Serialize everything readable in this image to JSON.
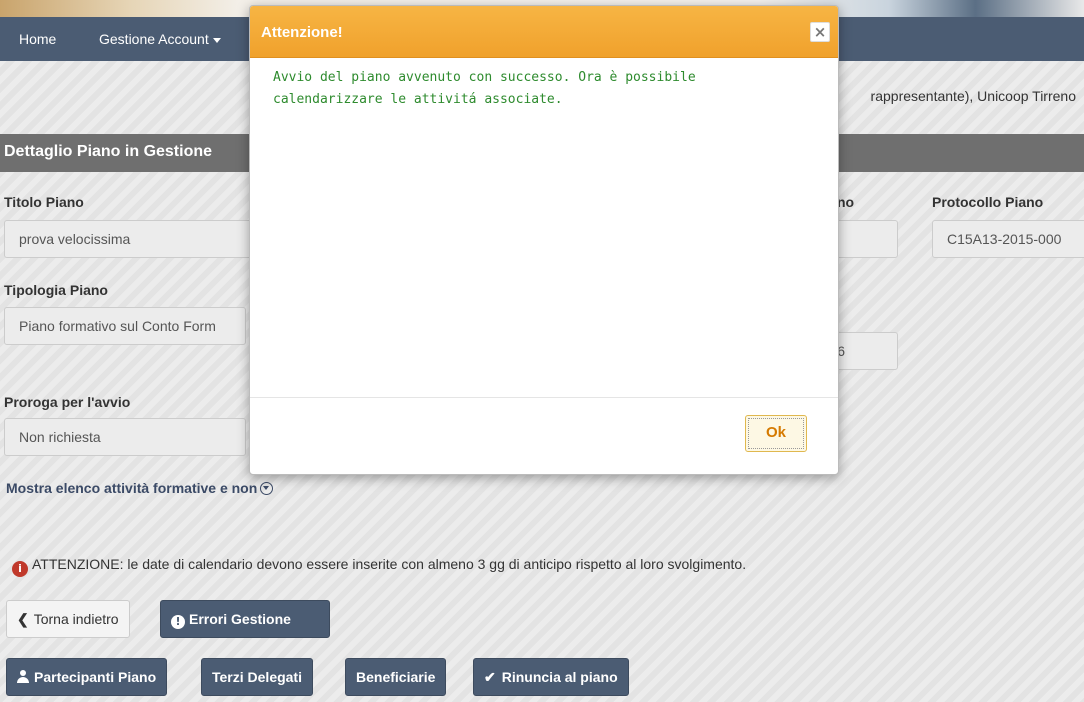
{
  "nav": {
    "home": "Home",
    "account": "Gestione Account"
  },
  "info": {
    "text": "rappresentante), Unicoop Tirreno"
  },
  "section": {
    "title": "Dettaglio Piano in Gestione"
  },
  "fields": {
    "titolo_label": "Titolo Piano",
    "titolo_value": "prova velocissima",
    "no_label": "no",
    "protocollo_label": "Protocollo Piano",
    "protocollo_value": "C15A13-2015-000",
    "tipologia_label": "Tipologia Piano",
    "tipologia_value": "Piano formativo sul Conto Form",
    "right_value": "6",
    "proroga_label": "Proroga per l'avvio",
    "proroga_value": "Non richiesta"
  },
  "show_list": "Mostra elenco attività formative e non",
  "warning": {
    "icon": "i",
    "text": "ATTENZIONE: le date di calendario devono essere inserite con almeno 3 gg di anticipo rispetto al loro svolgimento."
  },
  "buttons": {
    "back": "Torna indietro",
    "errors": "Errori Gestione",
    "participants": "Partecipanti Piano",
    "delegates": "Terzi Delegati",
    "beneficiaries": "Beneficiarie",
    "renounce": "Rinuncia al piano"
  },
  "modal": {
    "title": "Attenzione!",
    "close": "×",
    "message": "Avvio del piano avvenuto con successo. Ora è possibile calendarizzare le attivitá associate.",
    "ok": "Ok"
  }
}
